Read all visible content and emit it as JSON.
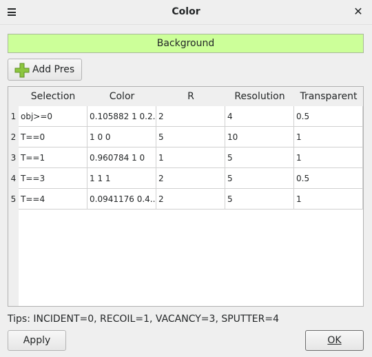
{
  "window": {
    "title": "Color"
  },
  "background_button": {
    "label": "Background",
    "color": "#ccff99"
  },
  "add_pres_button": {
    "label": "Add Pres",
    "icon": "plus-icon",
    "icon_color": "#8cc63f"
  },
  "table": {
    "columns": [
      "Selection",
      "Color",
      "R",
      "Resolution",
      "Transparent"
    ],
    "rows": [
      {
        "num": "1",
        "cells": [
          "obj>=0",
          "0.105882 1 0.2...",
          "2",
          "4",
          "0.5"
        ]
      },
      {
        "num": "2",
        "cells": [
          "T==0",
          "1 0 0",
          "5",
          "10",
          "1"
        ]
      },
      {
        "num": "3",
        "cells": [
          "T==1",
          "0.960784 1 0",
          "1",
          "5",
          "1"
        ]
      },
      {
        "num": "4",
        "cells": [
          "T==3",
          "1 1 1",
          "2",
          "5",
          "0.5"
        ]
      },
      {
        "num": "5",
        "cells": [
          "T==4",
          "0.0941176 0.4...",
          "2",
          "5",
          "1"
        ]
      }
    ]
  },
  "tips": "Tips: INCIDENT=0, RECOIL=1, VACANCY=3, SPUTTER=4",
  "footer": {
    "apply_label": "Apply",
    "ok_label": "OK"
  }
}
